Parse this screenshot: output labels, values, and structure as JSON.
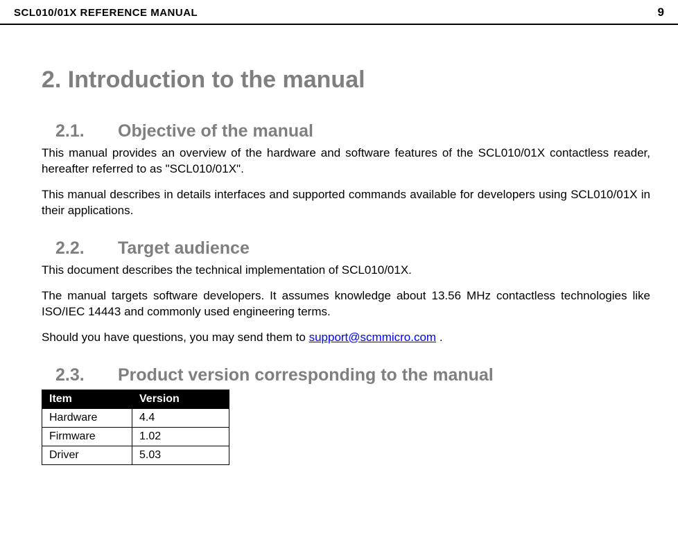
{
  "header": {
    "title": "SCL010/01X REFERENCE MANUAL",
    "page": "9"
  },
  "section": {
    "h1": "2. Introduction to the manual",
    "s21": {
      "num": "2.1.",
      "title": "Objective of the manual",
      "p1": "This manual provides an overview of the hardware and software features of the SCL010/01X contactless reader, hereafter referred to as \"SCL010/01X\".",
      "p2": "This manual describes in details interfaces and supported commands available for developers using SCL010/01X in their applications."
    },
    "s22": {
      "num": "2.2.",
      "title": "Target audience",
      "p1": "This document describes the technical implementation of SCL010/01X.",
      "p2": "The manual targets software developers. It assumes knowledge about 13.56 MHz contactless technologies like ISO/IEC 14443 and commonly used engineering terms.",
      "p3_pre": "Should you have questions, you may send them to ",
      "p3_link": "support@scmmicro.com",
      "p3_post": " ."
    },
    "s23": {
      "num": "2.3.",
      "title": "Product version corresponding to the manual",
      "table": {
        "head_item": "Item",
        "head_version": "Version",
        "rows": [
          {
            "item": "Hardware",
            "version": "4.4"
          },
          {
            "item": "Firmware",
            "version": "1.02"
          },
          {
            "item": "Driver",
            "version": "5.03"
          }
        ]
      }
    }
  }
}
